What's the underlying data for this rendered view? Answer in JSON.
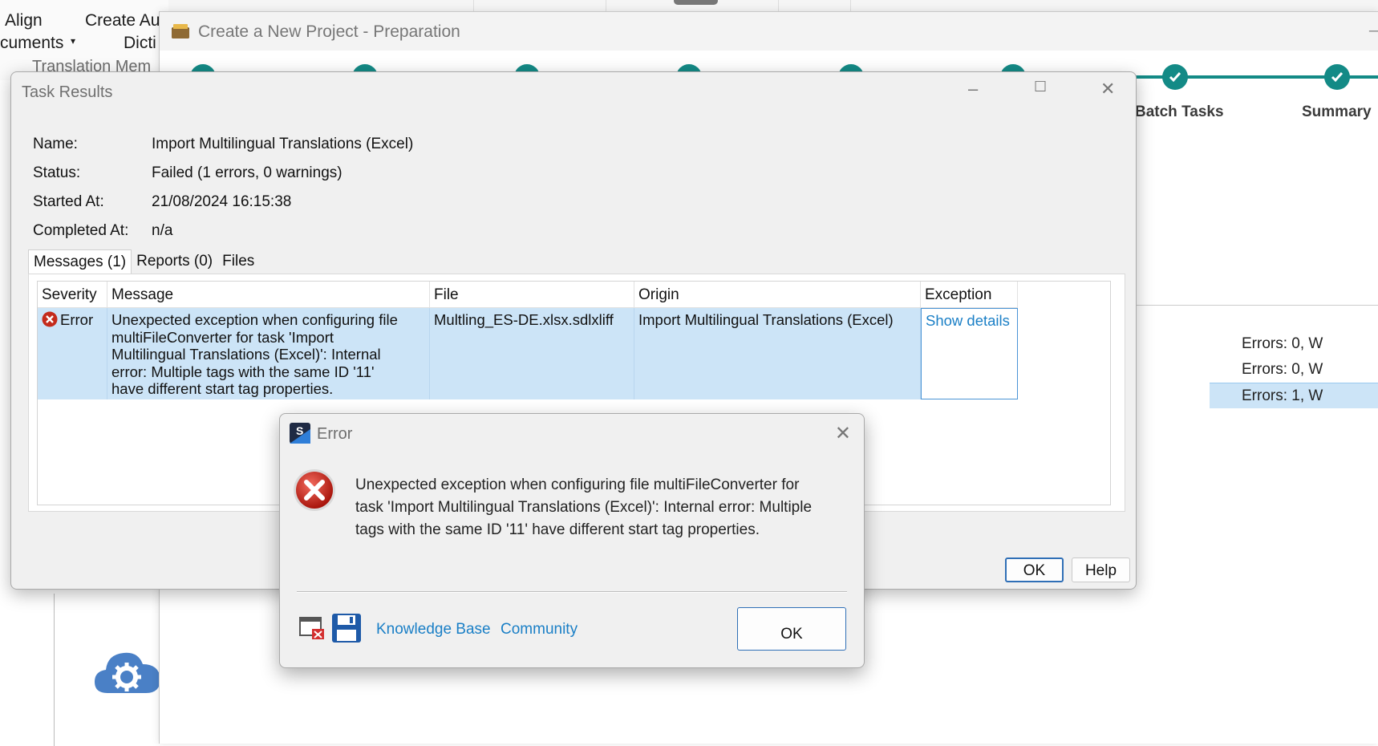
{
  "ribbon": {
    "align": "Align",
    "documents": "cuments",
    "create_auto": "Create Au",
    "dictionary": "Dicti",
    "translation_memory": "Translation Mem"
  },
  "wizard": {
    "title": "Create a New Project - Preparation",
    "steps": [
      {
        "label": ""
      },
      {
        "label": ""
      },
      {
        "label": ""
      },
      {
        "label": ""
      },
      {
        "label": ""
      },
      {
        "label": ""
      },
      {
        "label": "Batch Tasks"
      },
      {
        "label": "Summary"
      }
    ],
    "statuses": [
      "Errors: 0, W",
      "Errors: 0, W",
      "Errors: 1, W"
    ],
    "accent_color": "#138a86"
  },
  "task_results": {
    "title": "Task Results",
    "fields": {
      "name_label": "Name:",
      "name_value": "Import Multilingual Translations (Excel)",
      "status_label": "Status:",
      "status_value": "Failed (1 errors, 0 warnings)",
      "started_label": "Started At:",
      "started_value": "21/08/2024 16:15:38",
      "completed_label": "Completed At:",
      "completed_value": "n/a"
    },
    "tabs": [
      "Messages (1)",
      "Reports (0)",
      "Files"
    ],
    "columns": [
      "Severity",
      "Message",
      "File",
      "Origin",
      "Exception"
    ],
    "rows": [
      {
        "severity": "Error",
        "message_lines": [
          "Unexpected exception when configuring file",
          "multiFileConverter for task 'Import",
          "Multilingual Translations (Excel)': Internal",
          "error: Multiple tags with the same ID '11'",
          "have different start tag properties."
        ],
        "file": "Multling_ES-DE.xlsx.sdlxliff",
        "origin": "Import Multilingual Translations (Excel)",
        "exception": "Show details"
      }
    ],
    "ok_label": "OK",
    "help_label": "Help"
  },
  "error_dialog": {
    "title": "Error",
    "message_lines": [
      "Unexpected exception when configuring file multiFileConverter for",
      "task 'Import Multilingual Translations (Excel)': Internal error: Multiple",
      "tags with the same ID '11' have different start tag properties."
    ],
    "knowledge_base": "Knowledge Base",
    "community": "Community",
    "ok_label": "OK",
    "error_color": "#c42b1c",
    "link_color": "#1a7fc6"
  }
}
